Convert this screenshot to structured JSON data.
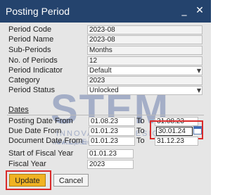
{
  "window": {
    "title": "Posting Period",
    "minimize": "_",
    "close": "✕"
  },
  "fields": {
    "period_code": {
      "label": "Period Code",
      "value": "2023-08"
    },
    "period_name": {
      "label": "Period Name",
      "value": "2023-08"
    },
    "sub_periods": {
      "label": "Sub-Periods",
      "value": "Months"
    },
    "no_of_periods": {
      "label": "No. of Periods",
      "value": "12"
    },
    "period_indicator": {
      "label": "Period Indicator",
      "value": "Default"
    },
    "category": {
      "label": "Category",
      "value": "2023"
    },
    "period_status": {
      "label": "Period Status",
      "value": "Unlocked"
    }
  },
  "dates": {
    "section_label": "Dates",
    "to_label": "To",
    "posting_date": {
      "label": "Posting Date From",
      "from": "01.08.23",
      "to": "31.08.23"
    },
    "due_date": {
      "label": "Due Date From",
      "from": "01.01.23",
      "to": "30.01.24"
    },
    "document_date": {
      "label": "Document Date From",
      "from": "01.01.23",
      "to": "31.12.23"
    }
  },
  "fiscal": {
    "start": {
      "label": "Start of Fiscal Year",
      "value": "01.01.23"
    },
    "year": {
      "label": "Fiscal Year",
      "value": "2023"
    }
  },
  "buttons": {
    "update": "Update",
    "cancel": "Cancel"
  },
  "watermark": {
    "brand": "STEM",
    "tagline": "INNOVATION • DESIGN • VALUE",
    "url": "www.sap-stemteam"
  },
  "colors": {
    "titlebar": "#24436d",
    "highlight": "#d92a2a",
    "primary_button": "#f0b323"
  }
}
